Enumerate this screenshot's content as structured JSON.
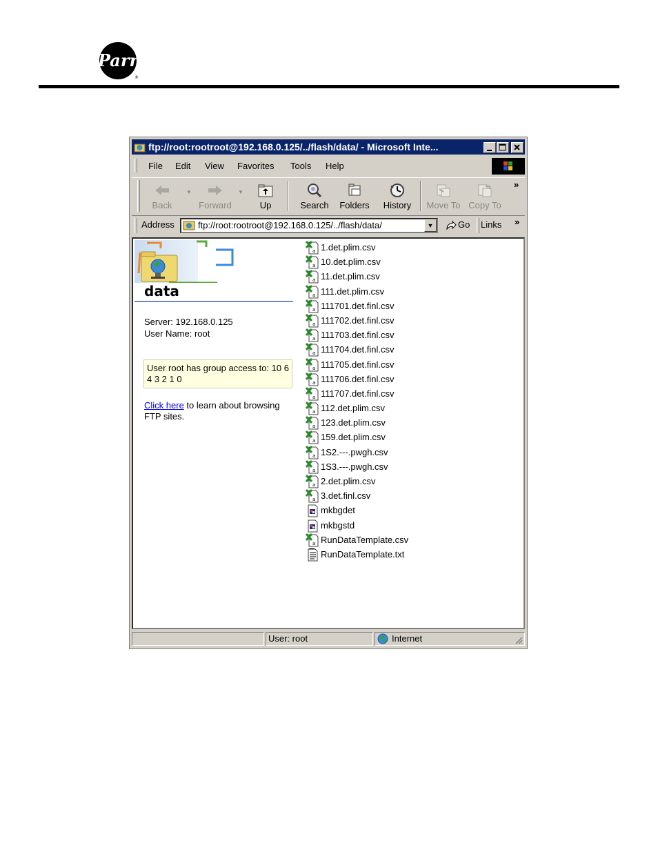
{
  "window": {
    "title": "ftp://root:rootroot@192.168.0.125/../flash/data/ - Microsoft Inte..."
  },
  "menu": [
    "File",
    "Edit",
    "View",
    "Favorites",
    "Tools",
    "Help"
  ],
  "toolbar": {
    "back": "Back",
    "forward": "Forward",
    "up": "Up",
    "search": "Search",
    "folders": "Folders",
    "history": "History",
    "move_to": "Move To",
    "copy_to": "Copy To",
    "more": "»"
  },
  "address": {
    "label": "Address",
    "value": "ftp://root:rootroot@192.168.0.125/../flash/data/",
    "go": "Go",
    "links": "Links",
    "links_more": "»"
  },
  "panel": {
    "folder_name": "data",
    "server_line": "Server: 192.168.0.125",
    "user_line": "User Name: root",
    "access_text": "User root has group access to: 10 6 4 3 2 1 0",
    "help_link": "Click here",
    "help_text": " to learn about browsing FTP sites."
  },
  "files": [
    {
      "name": "1.det.plim.csv",
      "icon": "excel-csv-icon"
    },
    {
      "name": "10.det.plim.csv",
      "icon": "excel-csv-icon"
    },
    {
      "name": "11.det.plim.csv",
      "icon": "excel-csv-icon"
    },
    {
      "name": "111.det.plim.csv",
      "icon": "excel-csv-icon"
    },
    {
      "name": "111701.det.finl.csv",
      "icon": "excel-csv-icon"
    },
    {
      "name": "111702.det.finl.csv",
      "icon": "excel-csv-icon"
    },
    {
      "name": "111703.det.finl.csv",
      "icon": "excel-csv-icon"
    },
    {
      "name": "111704.det.finl.csv",
      "icon": "excel-csv-icon"
    },
    {
      "name": "111705.det.finl.csv",
      "icon": "excel-csv-icon"
    },
    {
      "name": "111706.det.finl.csv",
      "icon": "excel-csv-icon"
    },
    {
      "name": "111707.det.finl.csv",
      "icon": "excel-csv-icon"
    },
    {
      "name": "112.det.plim.csv",
      "icon": "excel-csv-icon"
    },
    {
      "name": "123.det.plim.csv",
      "icon": "excel-csv-icon"
    },
    {
      "name": "159.det.plim.csv",
      "icon": "excel-csv-icon"
    },
    {
      "name": "1S2.---.pwgh.csv",
      "icon": "excel-csv-icon"
    },
    {
      "name": "1S3.---.pwgh.csv",
      "icon": "excel-csv-icon"
    },
    {
      "name": "2.det.plim.csv",
      "icon": "excel-csv-icon"
    },
    {
      "name": "3.det.finl.csv",
      "icon": "excel-csv-icon"
    },
    {
      "name": "mkbgdet",
      "icon": "executable-icon"
    },
    {
      "name": "mkbgstd",
      "icon": "executable-icon"
    },
    {
      "name": "RunDataTemplate.csv",
      "icon": "excel-csv-icon"
    },
    {
      "name": "RunDataTemplate.txt",
      "icon": "text-file-icon"
    }
  ],
  "status": {
    "user": "User: root",
    "zone": "Internet"
  }
}
